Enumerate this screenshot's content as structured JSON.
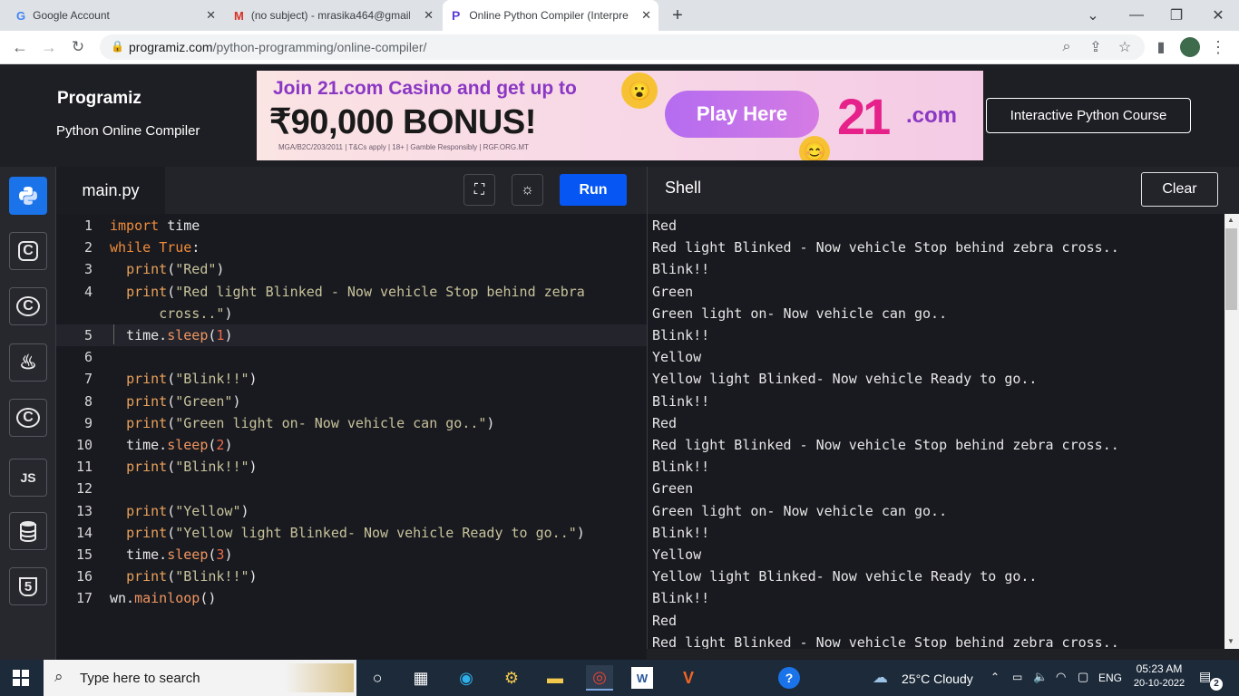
{
  "browser": {
    "tabs": [
      {
        "title": "Google Account",
        "icon": "google-icon"
      },
      {
        "title": "(no subject) - mrasika464@gmail",
        "icon": "gmail-icon"
      },
      {
        "title": "Online Python Compiler (Interpre",
        "icon": "programiz-icon"
      }
    ],
    "new_tab": "+",
    "url_host": "programiz.com",
    "url_path": "/python-programming/online-compiler/"
  },
  "site": {
    "logo": "Programiz",
    "subtitle": "Python Online Compiler",
    "course_button": "Interactive Python Course"
  },
  "ad": {
    "line1": "Join 21.com Casino and get up to",
    "line2": "₹90,000 BONUS!",
    "fine_print": "MGA/B2C/203/2011  |  T&Cs apply  |  18+  |  Gamble Responsibly  |  RGF.ORG.MT",
    "cta": "Play Here",
    "brand": "21",
    "brand_suffix": ".com"
  },
  "rail": [
    {
      "name": "python",
      "label": "",
      "icon": "python-icon",
      "active": true
    },
    {
      "name": "r",
      "label": "C",
      "icon": "r-icon"
    },
    {
      "name": "c",
      "label": "C",
      "icon": "c-icon"
    },
    {
      "name": "java",
      "label": "♨",
      "icon": "java-icon"
    },
    {
      "name": "cpp",
      "label": "C",
      "icon": "cpp-icon"
    },
    {
      "name": "js",
      "label": "JS",
      "icon": "js-icon"
    },
    {
      "name": "sql",
      "label": "",
      "icon": "database-icon"
    },
    {
      "name": "html",
      "label": "5",
      "icon": "html5-icon"
    }
  ],
  "editor": {
    "filename": "main.py",
    "run_label": "Run",
    "lines": [
      {
        "n": "1",
        "html": "<span class=\"kw\">import</span> time"
      },
      {
        "n": "2",
        "html": "<span class=\"kw\">while</span> <span class=\"kw\">True</span>:"
      },
      {
        "n": "3",
        "html": "  <span class=\"fn\">print</span>(<span class=\"str\">\"Red\"</span>)"
      },
      {
        "n": "4",
        "html": "  <span class=\"fn\">print</span>(<span class=\"str\">\"Red light Blinked - Now vehicle Stop behind zebra</span>"
      },
      {
        "n": "",
        "html": "      <span class=\"str\">cross..\"</span>)"
      },
      {
        "n": "5",
        "html": "  time.<span class=\"fnc\">sleep</span>(<span class=\"nm\">1</span>)"
      },
      {
        "n": "6",
        "html": ""
      },
      {
        "n": "7",
        "html": "  <span class=\"fn\">print</span>(<span class=\"str\">\"Blink!!\"</span>)"
      },
      {
        "n": "8",
        "html": "  <span class=\"fn\">print</span>(<span class=\"str\">\"Green\"</span>)"
      },
      {
        "n": "9",
        "html": "  <span class=\"fn\">print</span>(<span class=\"str\">\"Green light on- Now vehicle can go..\"</span>)"
      },
      {
        "n": "10",
        "html": "  time.<span class=\"fnc\">sleep</span>(<span class=\"nm\">2</span>)"
      },
      {
        "n": "11",
        "html": "  <span class=\"fn\">print</span>(<span class=\"str\">\"Blink!!\"</span>)"
      },
      {
        "n": "12",
        "html": ""
      },
      {
        "n": "13",
        "html": "  <span class=\"fn\">print</span>(<span class=\"str\">\"Yellow\"</span>)"
      },
      {
        "n": "14",
        "html": "  <span class=\"fn\">print</span>(<span class=\"str\">\"Yellow light Blinked- Now vehicle Ready to go..\"</span>)"
      },
      {
        "n": "15",
        "html": "  time.<span class=\"fnc\">sleep</span>(<span class=\"nm\">3</span>)"
      },
      {
        "n": "16",
        "html": "  <span class=\"fn\">print</span>(<span class=\"str\">\"Blink!!\"</span>)"
      },
      {
        "n": "17",
        "html": "wn.<span class=\"fnc\">mainloop</span>()"
      }
    ]
  },
  "shell": {
    "title": "Shell",
    "clear_label": "Clear",
    "output": [
      "Red",
      "Red light Blinked - Now vehicle Stop behind zebra cross..",
      "Blink!!",
      "Green",
      "Green light on- Now vehicle can go..",
      "Blink!!",
      "Yellow",
      "Yellow light Blinked- Now vehicle Ready to go..",
      "Blink!!",
      "Red",
      "Red light Blinked - Now vehicle Stop behind zebra cross..",
      "Blink!!",
      "Green",
      "Green light on- Now vehicle can go..",
      "Blink!!",
      "Yellow",
      "Yellow light Blinked- Now vehicle Ready to go..",
      "Blink!!",
      "Red",
      "Red light Blinked - Now vehicle Stop behind zebra cross.."
    ]
  },
  "taskbar": {
    "search_placeholder": "Type here to search",
    "weather": "25°C  Cloudy",
    "lang": "ENG",
    "time": "05:23 AM",
    "date": "20-10-2022",
    "notifications": "2"
  },
  "colors": {
    "run": "#0556f3",
    "active_rail": "#1a73e8",
    "keyword": "#f08c3a",
    "string": "#c7c29a"
  }
}
